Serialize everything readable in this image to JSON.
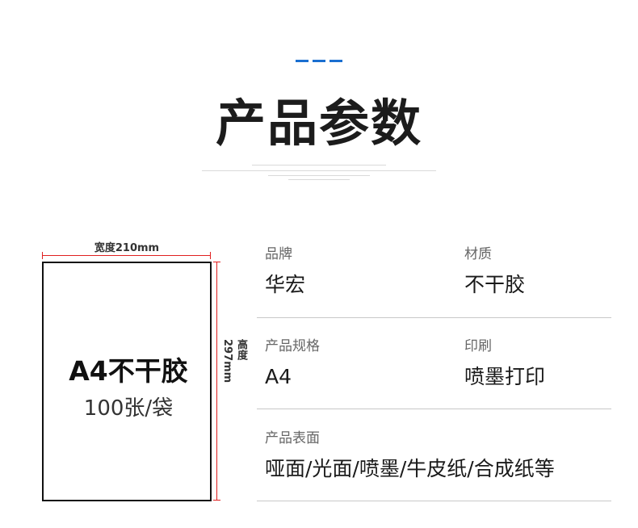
{
  "header": {
    "title": "产品参数",
    "accent_color": "#1a6fd0"
  },
  "sheet_diagram": {
    "width_label": "宽度210mm",
    "height_label": "高度297mm",
    "main_text": "A4不干胶",
    "sub_text": "100张/袋",
    "dimension_color": "#e02020"
  },
  "params": [
    {
      "label": "品牌",
      "value": "华宏"
    },
    {
      "label": "材质",
      "value": "不干胶"
    },
    {
      "label": "产品规格",
      "value": "A4"
    },
    {
      "label": "印刷",
      "value": "喷墨打印"
    },
    {
      "label": "产品表面",
      "value": "哑面/光面/喷墨/牛皮纸/合成纸等"
    }
  ]
}
